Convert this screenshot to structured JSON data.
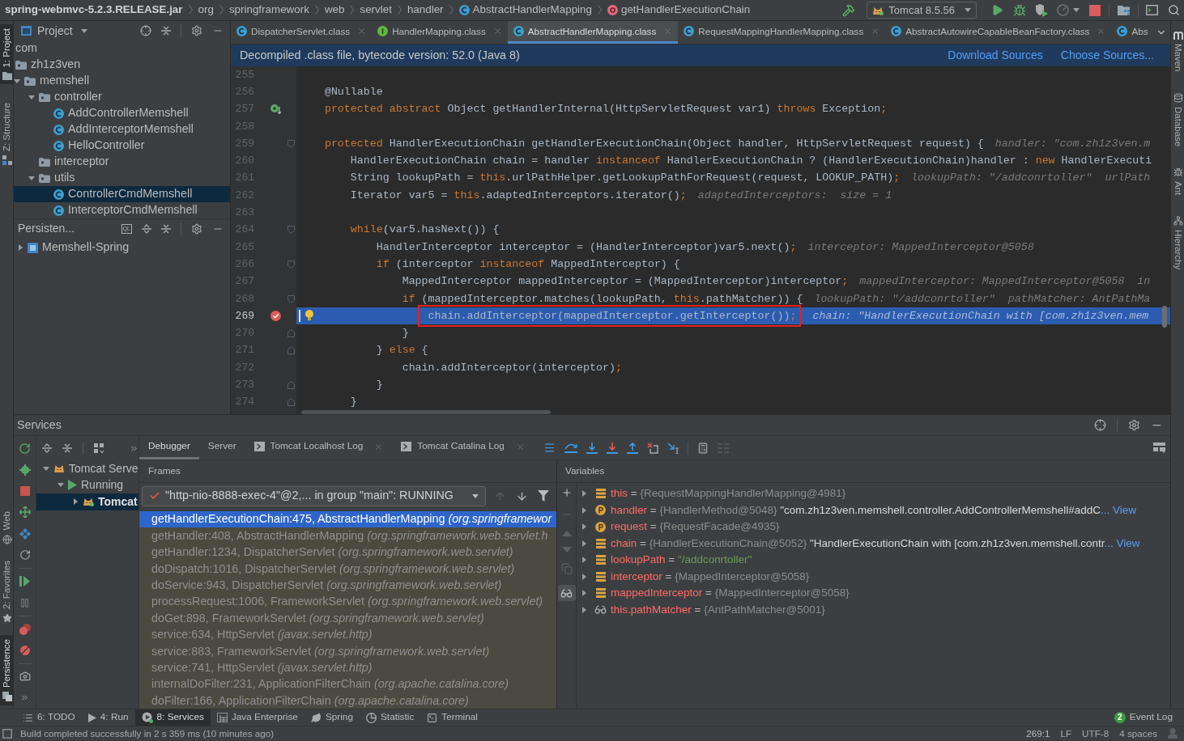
{
  "navbar": {
    "breadcrumbs": [
      {
        "label": "spring-webmvc-5.2.3.RELEASE.jar",
        "kind": "jar"
      },
      {
        "label": "org",
        "kind": "package"
      },
      {
        "label": "springframework",
        "kind": "package"
      },
      {
        "label": "web",
        "kind": "package"
      },
      {
        "label": "servlet",
        "kind": "package"
      },
      {
        "label": "handler",
        "kind": "package"
      },
      {
        "label": "AbstractHandlerMapping",
        "kind": "class"
      },
      {
        "label": "getHandlerExecutionChain",
        "kind": "method"
      }
    ],
    "run_config": "Tomcat 8.5.56"
  },
  "left_strip": {
    "top": [
      {
        "label": "1: Project",
        "selected": true
      },
      {
        "label": "Z: Structure",
        "selected": false
      }
    ],
    "bottom": [
      {
        "label": "Web",
        "selected": false
      },
      {
        "label": "2: Favorites",
        "selected": false
      },
      {
        "label": "Persistence",
        "selected": true
      }
    ]
  },
  "project_panel": {
    "title": "Project",
    "tree": [
      {
        "label": "com",
        "selected": false,
        "children": [
          {
            "label": "zh1z3ven",
            "kind": "package",
            "selected": false,
            "children": [
              {
                "label": "memshell",
                "kind": "package",
                "expanded": true,
                "selected": false,
                "children": [
                  {
                    "label": "controller",
                    "kind": "package",
                    "expanded": true,
                    "selected": false,
                    "children": [
                      {
                        "label": "AddControllerMemshell",
                        "kind": "class",
                        "selected": false
                      },
                      {
                        "label": "AddInterceptorMemshell",
                        "kind": "class",
                        "selected": false
                      },
                      {
                        "label": "HelloController",
                        "kind": "class",
                        "selected": false
                      }
                    ]
                  },
                  {
                    "label": "interceptor",
                    "kind": "package",
                    "selected": false
                  },
                  {
                    "label": "utils",
                    "kind": "package",
                    "expanded": true,
                    "selected": false,
                    "children": [
                      {
                        "label": "ControllerCmdMemshell",
                        "kind": "class",
                        "selected": true
                      },
                      {
                        "label": "InterceptorCmdMemshell",
                        "kind": "class",
                        "selected": false
                      }
                    ]
                  }
                ]
              }
            ]
          }
        ]
      }
    ]
  },
  "persistence_panel": {
    "title": "Persisten...",
    "console_label": "QL",
    "tree": [
      {
        "label": "Memshell-Spring",
        "kind": "module",
        "expanded": false,
        "selected": false
      }
    ]
  },
  "editor": {
    "tabs": [
      {
        "label": "DispatcherServlet.class",
        "kind": "class",
        "closable": true,
        "selected": false
      },
      {
        "label": "HandlerMapping.class",
        "kind": "interface",
        "closable": true,
        "selected": false
      },
      {
        "label": "AbstractHandlerMapping.class",
        "kind": "class",
        "closable": true,
        "selected": true
      },
      {
        "label": "RequestMappingHandlerMapping.class",
        "kind": "class",
        "closable": true,
        "selected": false
      },
      {
        "label": "AbstractAutowireCapableBeanFactory.class",
        "kind": "class",
        "closable": true,
        "selected": false
      },
      {
        "label": "Abs",
        "kind": "class",
        "closable": false,
        "selected": false
      }
    ],
    "banner": {
      "text": "Decompiled .class file, bytecode version: 52.0 (Java 8)",
      "links": [
        "Download Sources",
        "Choose Sources..."
      ]
    },
    "lines": [
      {
        "number": "255",
        "current": false,
        "boxed": false
      },
      {
        "number": "256",
        "code": [
          {
            "text": "    @Nullable",
            "kind": "plain"
          }
        ],
        "current": false,
        "boxed": false
      },
      {
        "number": "257",
        "code": [
          {
            "text": "    protected abstract",
            "kind": "keyword"
          },
          {
            "text": " Object getHandlerInternal(HttpServletRequest var1) ",
            "kind": "plain"
          },
          {
            "text": "throws",
            "kind": "keyword"
          },
          {
            "text": " Exception",
            "kind": "plain"
          },
          {
            "text": ";",
            "kind": "keyword"
          }
        ],
        "marker": {
          "kind": "implemented"
        },
        "current": false,
        "boxed": false
      },
      {
        "number": "258",
        "current": false,
        "boxed": false
      },
      {
        "number": "259",
        "code": [
          {
            "text": "    protected",
            "kind": "keyword"
          },
          {
            "text": " HandlerExecutionChain getHandlerExecutionChain(Object handler, HttpServletRequest request) {",
            "kind": "plain"
          }
        ],
        "hint": "handler: \"com.zh1z3ven.m",
        "fold": {
          "kind": "start"
        },
        "current": false,
        "boxed": false
      },
      {
        "number": "260",
        "code": [
          {
            "text": "        HandlerExecutionChain chain = handler ",
            "kind": "plain"
          },
          {
            "text": "instanceof",
            "kind": "keyword"
          },
          {
            "text": " HandlerExecutionChain ? (HandlerExecutionChain)handler : ",
            "kind": "plain"
          },
          {
            "text": "new",
            "kind": "keyword"
          },
          {
            "text": " HandlerExecuti",
            "kind": "plain"
          }
        ],
        "current": false,
        "boxed": false
      },
      {
        "number": "261",
        "code": [
          {
            "text": "        String lookupPath = ",
            "kind": "plain"
          },
          {
            "text": "this",
            "kind": "keyword"
          },
          {
            "text": ".urlPathHelper.getLookupPathForRequest(request, LOOKUP_PATH)",
            "kind": "plain"
          },
          {
            "text": ";",
            "kind": "keyword"
          }
        ],
        "hint": "lookupPath: \"/addconrtoller\"  urlPath",
        "current": false,
        "boxed": false
      },
      {
        "number": "262",
        "code": [
          {
            "text": "        Iterator var5 = ",
            "kind": "plain"
          },
          {
            "text": "this",
            "kind": "keyword"
          },
          {
            "text": ".adaptedInterceptors.iterator()",
            "kind": "plain"
          },
          {
            "text": ";",
            "kind": "keyword"
          }
        ],
        "hint": "adaptedInterceptors:  size = 1",
        "current": false,
        "boxed": false
      },
      {
        "number": "263",
        "current": false,
        "boxed": false
      },
      {
        "number": "264",
        "code": [
          {
            "text": "        while",
            "kind": "keyword"
          },
          {
            "text": "(var5.hasNext()) {",
            "kind": "plain"
          }
        ],
        "fold": {
          "kind": "start"
        },
        "current": false,
        "boxed": false
      },
      {
        "number": "265",
        "code": [
          {
            "text": "            HandlerInterceptor interceptor = (HandlerInterceptor)var5.next()",
            "kind": "plain"
          },
          {
            "text": ";",
            "kind": "keyword"
          }
        ],
        "hint": "interceptor: MappedInterceptor@5058",
        "current": false,
        "boxed": false
      },
      {
        "number": "266",
        "code": [
          {
            "text": "            if",
            "kind": "keyword"
          },
          {
            "text": " (interceptor ",
            "kind": "plain"
          },
          {
            "text": "instanceof",
            "kind": "keyword"
          },
          {
            "text": " MappedInterceptor) {",
            "kind": "plain"
          }
        ],
        "fold": {
          "kind": "start"
        },
        "current": false,
        "boxed": false
      },
      {
        "number": "267",
        "code": [
          {
            "text": "                MappedInterceptor mappedInterceptor = (MappedInterceptor)interceptor",
            "kind": "plain"
          },
          {
            "text": ";",
            "kind": "keyword"
          }
        ],
        "hint": "mappedInterceptor: MappedInterceptor@5058  in",
        "current": false,
        "boxed": false
      },
      {
        "number": "268",
        "code": [
          {
            "text": "                if",
            "kind": "keyword"
          },
          {
            "text": " (mappedInterceptor.matches(lookupPath, ",
            "kind": "plain"
          },
          {
            "text": "this",
            "kind": "keyword"
          },
          {
            "text": ".pathMatcher)) {",
            "kind": "plain"
          }
        ],
        "hint": "lookupPath: \"/addconrtoller\"  pathMatcher: AntPathMa",
        "fold": {
          "kind": "start"
        },
        "current": false,
        "boxed": false
      },
      {
        "number": "269",
        "code": [
          {
            "text": "                    chain.addInterceptor(mappedInterceptor.getInterceptor())",
            "kind": "plain"
          },
          {
            "text": ";",
            "kind": "keyword"
          }
        ],
        "hint": "chain: \"HandlerExecutionChain with [com.zh1z3ven.mem",
        "marker": {
          "kind": "breakpoint"
        },
        "current": true,
        "boxed": true
      },
      {
        "number": "270",
        "code": [
          {
            "text": "                }",
            "kind": "plain"
          }
        ],
        "fold": {
          "kind": "end"
        },
        "current": false,
        "boxed": false
      },
      {
        "number": "271",
        "code": [
          {
            "text": "            } ",
            "kind": "plain"
          },
          {
            "text": "else",
            "kind": "keyword"
          },
          {
            "text": " {",
            "kind": "plain"
          }
        ],
        "fold": {
          "kind": "end"
        },
        "current": false,
        "boxed": false
      },
      {
        "number": "272",
        "code": [
          {
            "text": "                chain.addInterceptor(interceptor)",
            "kind": "plain"
          },
          {
            "text": ";",
            "kind": "keyword"
          }
        ],
        "current": false,
        "boxed": false
      },
      {
        "number": "273",
        "code": [
          {
            "text": "            }",
            "kind": "plain"
          }
        ],
        "fold": {
          "kind": "end"
        },
        "current": false,
        "boxed": false
      },
      {
        "number": "274",
        "code": [
          {
            "text": "        }",
            "kind": "plain"
          }
        ],
        "fold": {
          "kind": "end"
        },
        "current": false,
        "boxed": false
      }
    ]
  },
  "right_strip": [
    {
      "label": "Maven",
      "selected": false
    },
    {
      "label": "Database",
      "selected": false
    },
    {
      "label": "Ant",
      "selected": false
    },
    {
      "label": "Hierarchy",
      "selected": false
    }
  ],
  "services": {
    "title": "Services",
    "tree": [
      {
        "label": "Tomcat Serve",
        "kind": "server",
        "expanded": true,
        "selected": false,
        "children": [
          {
            "label": "Running",
            "kind": "status",
            "expanded": true,
            "selected": false,
            "children": [
              {
                "label": "Tomcat",
                "kind": "deployment",
                "expanded": false,
                "selected": true
              }
            ]
          }
        ]
      }
    ],
    "tabs": [
      {
        "label": "Debugger",
        "kind": "plain",
        "closable": false,
        "selected": true
      },
      {
        "label": "Server",
        "kind": "plain",
        "closable": false,
        "selected": false
      },
      {
        "label": "Tomcat Localhost Log",
        "kind": "log",
        "closable": true,
        "selected": false
      },
      {
        "label": "Tomcat Catalina Log",
        "kind": "log",
        "closable": true,
        "selected": false
      }
    ],
    "frames": {
      "title": "Frames",
      "thread": "\"http-nio-8888-exec-4\"@2,... in group \"main\": RUNNING",
      "items": [
        {
          "method": "getHandlerExecutionChain:475, AbstractHandlerMapping",
          "package": "(org.springframewor",
          "selected": true
        },
        {
          "method": "getHandler:408, AbstractHandlerMapping",
          "package": "(org.springframework.web.servlet.h",
          "selected": false
        },
        {
          "method": "getHandler:1234, DispatcherServlet",
          "package": "(org.springframework.web.servlet)",
          "selected": false
        },
        {
          "method": "doDispatch:1016, DispatcherServlet",
          "package": "(org.springframework.web.servlet)",
          "selected": false
        },
        {
          "method": "doService:943, DispatcherServlet",
          "package": "(org.springframework.web.servlet)",
          "selected": false
        },
        {
          "method": "processRequest:1006, FrameworkServlet",
          "package": "(org.springframework.web.servlet)",
          "selected": false
        },
        {
          "method": "doGet:898, FrameworkServlet",
          "package": "(org.springframework.web.servlet)",
          "selected": false
        },
        {
          "method": "service:634, HttpServlet",
          "package": "(javax.servlet.http)",
          "selected": false
        },
        {
          "method": "service:883, FrameworkServlet",
          "package": "(org.springframework.web.servlet)",
          "selected": false
        },
        {
          "method": "service:741, HttpServlet",
          "package": "(javax.servlet.http)",
          "selected": false
        },
        {
          "method": "internalDoFilter:231, ApplicationFilterChain",
          "package": "(org.apache.catalina.core)",
          "selected": false
        },
        {
          "method": "doFilter:166, ApplicationFilterChain",
          "package": "(org.apache.catalina.core)",
          "selected": false
        }
      ]
    },
    "variables": {
      "title": "Variables",
      "items": [
        {
          "kind": "field",
          "name": "this",
          "sep": "=",
          "type": "{RequestMappingHandlerMapping@4981}",
          "expanded": false,
          "selected": false
        },
        {
          "kind": "parameter",
          "name": "handler",
          "sep": "=",
          "type": "{HandlerMethod@5048}",
          "value": "\"com.zh1z3ven.memshell.controller.AddControllerMemshell#addC",
          "link": "... View",
          "expanded": false,
          "selected": false
        },
        {
          "kind": "parameter",
          "name": "request",
          "sep": "=",
          "type": "{RequestFacade@4935}",
          "expanded": false,
          "selected": false
        },
        {
          "kind": "field",
          "name": "chain",
          "sep": "=",
          "type": "{HandlerExecutionChain@5052}",
          "value": "\"HandlerExecutionChain with [com.zh1z3ven.memshell.contr",
          "link": "... View",
          "expanded": false,
          "selected": false
        },
        {
          "kind": "field",
          "name": "lookupPath",
          "sep": "=",
          "literal": "\"/addconrtoller\"",
          "expanded": false,
          "selected": false
        },
        {
          "kind": "field",
          "name": "interceptor",
          "sep": "=",
          "type": "{MappedInterceptor@5058}",
          "expanded": false,
          "selected": false
        },
        {
          "kind": "field",
          "name": "mappedInterceptor",
          "sep": "=",
          "type": "{MappedInterceptor@5058}",
          "expanded": false,
          "selected": false
        },
        {
          "kind": "watch",
          "name": "this.pathMatcher",
          "sep": "=",
          "type": "{AntPathMatcher@5001}",
          "expanded": false,
          "selected": false
        }
      ]
    }
  },
  "tool_windows": [
    {
      "label": "6: TODO",
      "selected": false
    },
    {
      "label": "4: Run",
      "selected": false
    },
    {
      "label": "8: Services",
      "selected": true
    },
    {
      "label": "Java Enterprise",
      "selected": false
    },
    {
      "label": "Spring",
      "selected": false
    },
    {
      "label": "Statistic",
      "selected": false
    },
    {
      "label": "Terminal",
      "selected": false
    }
  ],
  "event_log": {
    "label": "Event Log",
    "count": "2"
  },
  "status_bar": {
    "message": "Build completed successfully in 2 s 359 ms (10 minutes ago)",
    "position": "269:1",
    "line_separator": "LF",
    "encoding": "UTF-8",
    "indent": "4 spaces"
  }
}
